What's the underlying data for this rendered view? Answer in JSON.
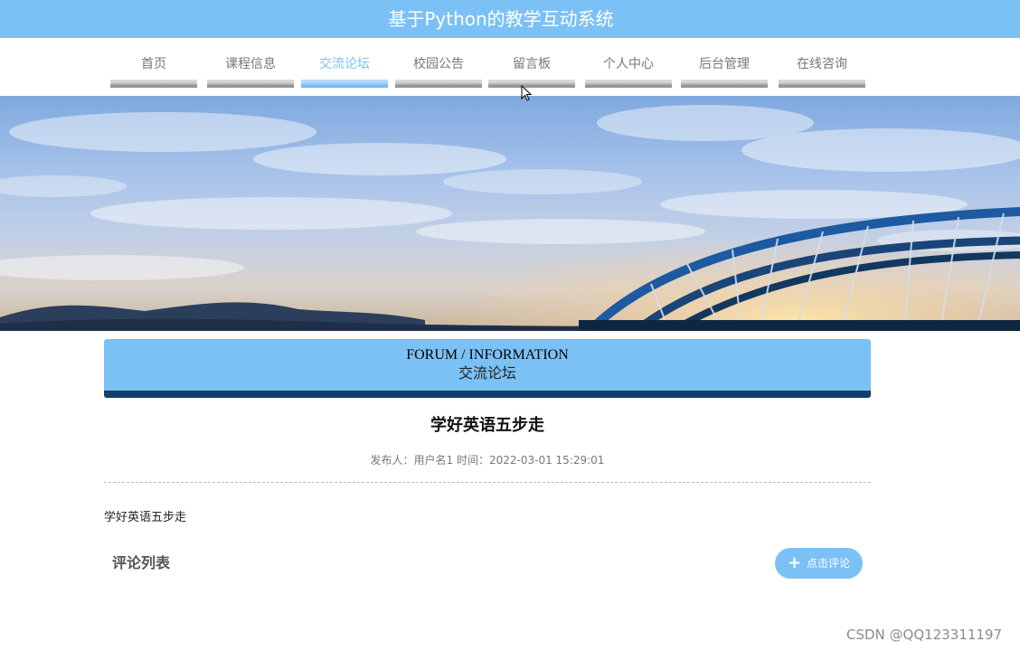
{
  "header": {
    "title": "基于Python的教学互动系统"
  },
  "nav": {
    "items": [
      {
        "label": "首页"
      },
      {
        "label": "课程信息"
      },
      {
        "label": "交流论坛",
        "active": true
      },
      {
        "label": "校园公告"
      },
      {
        "label": "留言板"
      },
      {
        "label": "个人中心"
      },
      {
        "label": "后台管理"
      },
      {
        "label": "在线咨询"
      }
    ]
  },
  "section": {
    "title_en": "FORUM / INFORMATION",
    "title_cn": "交流论坛"
  },
  "post": {
    "title": "学好英语五步走",
    "meta": "发布人：用户名1 时间：2022-03-01 15:29:01",
    "content": "学好英语五步走"
  },
  "comments": {
    "title": "评论列表",
    "button_label": "点击评论",
    "button_icon": "plus-icon"
  },
  "watermark": "CSDN @QQ123311197",
  "colors": {
    "primary": "#7cc1f5",
    "dark_accent": "#123f6b"
  }
}
